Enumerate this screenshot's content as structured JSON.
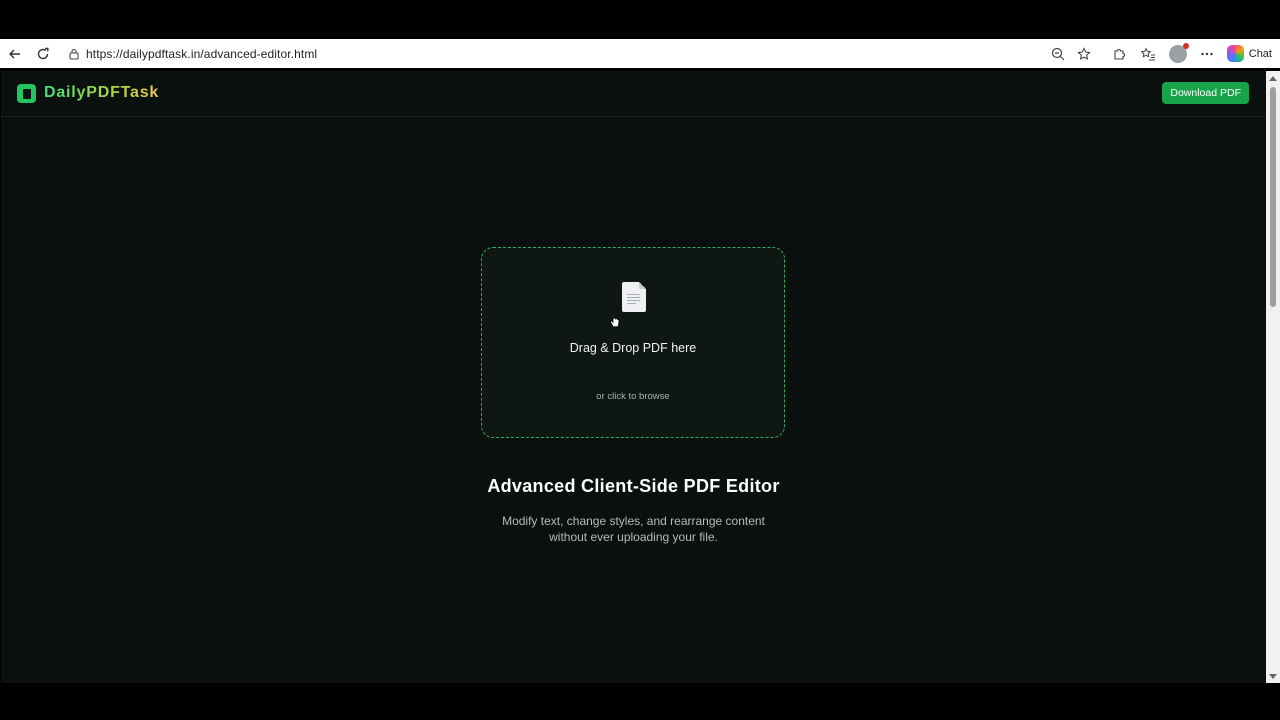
{
  "browser": {
    "url": "https://dailypdftask.in/advanced-editor.html",
    "chat_label": "Chat"
  },
  "site": {
    "logo_text": "DailyPDFTask",
    "download_label": "Download PDF"
  },
  "dropzone": {
    "title": "Drag & Drop PDF here",
    "subtitle": "or click to browse"
  },
  "hero": {
    "title": "Advanced Client-Side PDF Editor",
    "subtitle_line1": "Modify text, change styles, and rearrange content",
    "subtitle_line2": "without ever uploading your file."
  },
  "colors": {
    "accent": "#16a34a",
    "page_bg": "#0a100d",
    "dropzone_border": "#2fae63"
  }
}
